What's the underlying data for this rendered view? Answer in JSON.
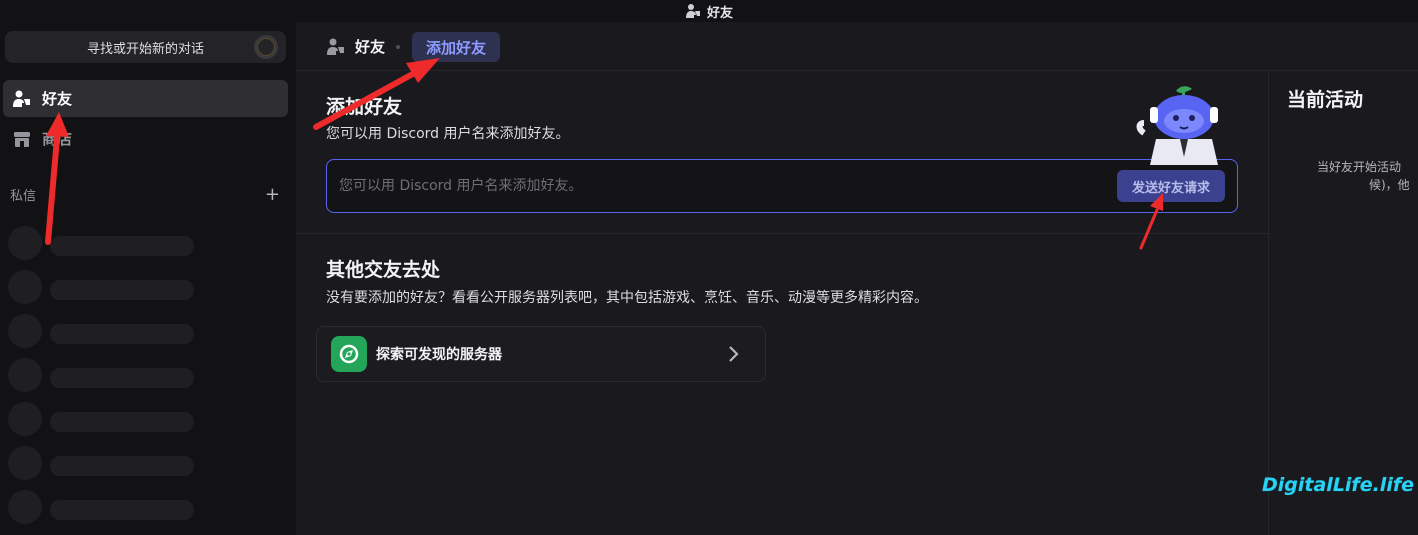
{
  "window": {
    "title": "好友"
  },
  "sidebar": {
    "search_label": "寻找或开始新的对话",
    "items": [
      {
        "label": "好友",
        "icon": "friends-icon",
        "active": true
      },
      {
        "label": "商店",
        "icon": "shop-icon",
        "active": false
      }
    ],
    "dm_header": "私信",
    "dm_add": "+"
  },
  "topbar": {
    "friends_label": "好友",
    "add_friend_tab": "添加好友"
  },
  "main": {
    "add_friend": {
      "title": "添加好友",
      "subtitle": "您可以用 Discord 用户名来添加好友。",
      "input_placeholder": "您可以用 Discord 用户名来添加好友。",
      "send_button": "发送好友请求"
    },
    "other": {
      "title": "其他交友去处",
      "subtitle": "没有要添加的好友？看看公开服务器列表吧，其中包括游戏、烹饪、音乐、动漫等更多精彩内容。",
      "explore_label": "探索可发现的服务器"
    }
  },
  "right_panel": {
    "title": "当前活动",
    "text_line1": "当好友开始活动",
    "text_line2": "候)，他"
  },
  "watermark": "DigitalLife.life",
  "colors": {
    "accent": "#5865f2",
    "explore_green": "#23a55a",
    "annotation_red": "#ee2a2a"
  }
}
